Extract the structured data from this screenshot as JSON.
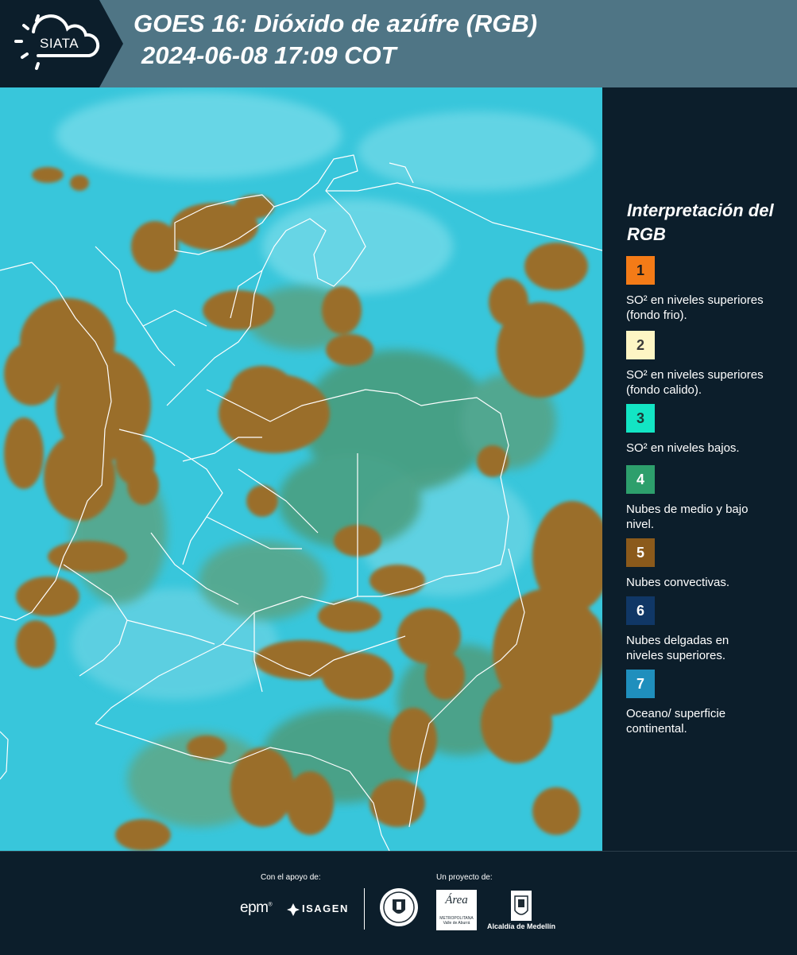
{
  "header": {
    "logo_text": "SIATA",
    "title_line1": "GOES 16: Dióxido de azúfre (RGB)",
    "title_line2": "2024-06-08 17:09 COT"
  },
  "legend": {
    "title": "Interpretación del RGB",
    "items": [
      {
        "number": "1",
        "color": "#f47b17",
        "num_color": "#1b1b1b",
        "text": "SO² en niveles superiores (fondo frio)."
      },
      {
        "number": "2",
        "color": "#fdf5c4",
        "num_color": "#3a3a3a",
        "text": "SO² en niveles superiores (fondo calido)."
      },
      {
        "number": "3",
        "color": "#13e5c4",
        "num_color": "#1b3a35",
        "text": "SO² en niveles bajos."
      },
      {
        "number": "4",
        "color": "#2d9f6c",
        "num_color": "#ffffff",
        "text": "Nubes de medio y bajo nivel."
      },
      {
        "number": "5",
        "color": "#8b5a1b",
        "num_color": "#ffffff",
        "text": "Nubes convectivas."
      },
      {
        "number": "6",
        "color": "#103766",
        "num_color": "#ffffff",
        "text": "Nubes delgadas en niveles superiores."
      },
      {
        "number": "7",
        "color": "#1f8fbd",
        "num_color": "#ffffff",
        "text": "Oceano/ superficie continental."
      }
    ]
  },
  "footer": {
    "support_label": "Con el apoyo de:",
    "project_label": "Un proyecto de:",
    "epm": "epm",
    "isagen": "ISAGEN",
    "area_logo": "Área",
    "area_sub": "METROPOLITANA Valle de Aburrá",
    "alcaldia": "Alcaldía de Medellín"
  },
  "colors": {
    "header_bg": "#4f7585",
    "panel_bg": "#0c1e2b",
    "ocean": "#38c6db",
    "convective": "#9a6e2c",
    "midlevel": "#3f8f6e"
  }
}
